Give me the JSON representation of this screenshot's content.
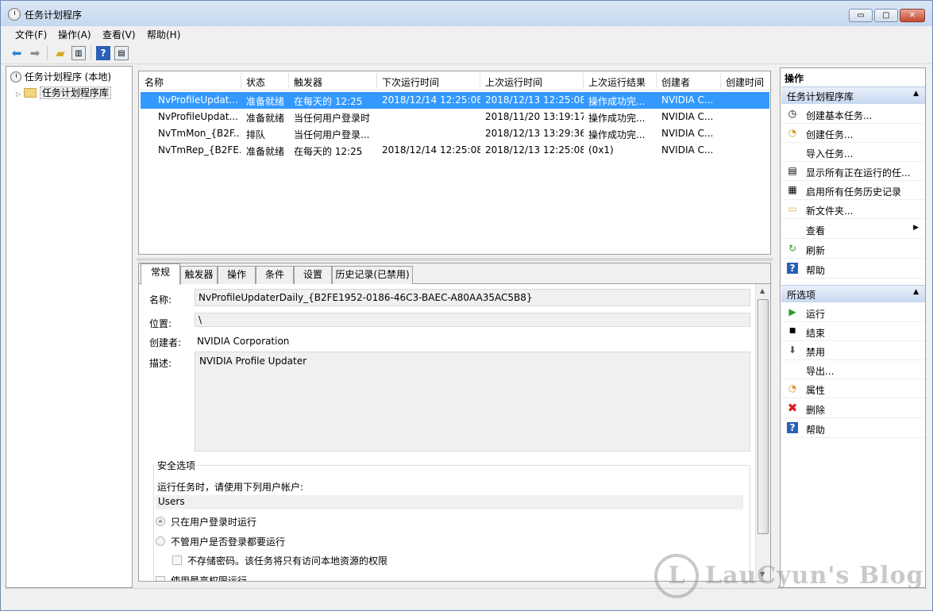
{
  "window": {
    "title": "任务计划程序",
    "buttons": {
      "minimize": "▭",
      "maximize": "▢",
      "close": "✕"
    }
  },
  "menu": [
    "文件(F)",
    "操作(A)",
    "查看(V)",
    "帮助(H)"
  ],
  "toolbar_icons": [
    "back-arrow-icon",
    "forward-arrow-icon",
    "up-folder-icon",
    "show-hide-tree-icon",
    "help-icon",
    "show-hide-action-pane-icon"
  ],
  "tree": {
    "root": "任务计划程序 (本地)",
    "child": "任务计划程序库"
  },
  "task_list": {
    "columns": [
      "名称",
      "状态",
      "触发器",
      "下次运行时间",
      "上次运行时间",
      "上次运行结果",
      "创建者",
      "创建时间"
    ],
    "rows": [
      {
        "name": "NvProfileUpdat...",
        "status": "准备就绪",
        "trigger": "在每天的 12:25",
        "next": "2018/12/14 12:25:08",
        "last": "2018/12/13 12:25:08",
        "result": "操作成功完...",
        "author": "NVIDIA C..."
      },
      {
        "name": "NvProfileUpdat...",
        "status": "准备就绪",
        "trigger": "当任何用户登录时",
        "next": "",
        "last": "2018/11/20 13:19:17",
        "result": "操作成功完...",
        "author": "NVIDIA C..."
      },
      {
        "name": "NvTmMon_{B2F...",
        "status": "排队",
        "trigger": "当任何用户登录...",
        "next": "",
        "last": "2018/12/13 13:29:36",
        "result": "操作成功完...",
        "author": "NVIDIA C..."
      },
      {
        "name": "NvTmRep_{B2FE...",
        "status": "准备就绪",
        "trigger": "在每天的 12:25",
        "next": "2018/12/14 12:25:08",
        "last": "2018/12/13 12:25:08",
        "result": "(0x1)",
        "author": "NVIDIA C..."
      }
    ]
  },
  "details": {
    "tabs": [
      "常规",
      "触发器",
      "操作",
      "条件",
      "设置",
      "历史记录(已禁用)"
    ],
    "name_label": "名称:",
    "name_value": "NvProfileUpdaterDaily_{B2FE1952-0186-46C3-BAEC-A80AA35AC5B8}",
    "location_label": "位置:",
    "location_value": "\\",
    "author_label": "创建者:",
    "author_value": "NVIDIA Corporation",
    "desc_label": "描述:",
    "desc_value": "NVIDIA Profile Updater",
    "security": {
      "title": "安全选项",
      "run_as_label": "运行任务时，请使用下列用户帐户:",
      "user": "Users",
      "opt_logged_on": "只在用户登录时运行",
      "opt_whether": "不管用户是否登录都要运行",
      "no_store_pwd": "不存储密码。该任务将只有访问本地资源的权限",
      "highest": "使用最高权限运行"
    }
  },
  "actions": {
    "title": "操作",
    "section1": {
      "header": "任务计划程序库",
      "items": [
        {
          "label": "创建基本任务...",
          "icon": "create-basic-task-icon",
          "glyph": "◷"
        },
        {
          "label": "创建任务...",
          "icon": "create-task-icon",
          "glyph": "◔"
        },
        {
          "label": "导入任务...",
          "icon": "",
          "glyph": ""
        },
        {
          "label": "显示所有正在运行的任...",
          "icon": "running-tasks-icon",
          "glyph": "▤"
        },
        {
          "label": "启用所有任务历史记录",
          "icon": "history-icon",
          "glyph": "▦"
        },
        {
          "label": "新文件夹...",
          "icon": "new-folder-icon",
          "glyph": "▭"
        },
        {
          "label": "查看",
          "icon": "",
          "glyph": "",
          "submenu": "▶"
        },
        {
          "label": "刷新",
          "icon": "refresh-icon",
          "glyph": "↻"
        },
        {
          "label": "帮助",
          "icon": "help-icon",
          "glyph": "?"
        }
      ]
    },
    "section2": {
      "header": "所选项",
      "items": [
        {
          "label": "运行",
          "icon": "run-icon",
          "glyph": "▶"
        },
        {
          "label": "结束",
          "icon": "stop-icon",
          "glyph": "■"
        },
        {
          "label": "禁用",
          "icon": "disable-icon",
          "glyph": "⬇"
        },
        {
          "label": "导出...",
          "icon": "",
          "glyph": ""
        },
        {
          "label": "属性",
          "icon": "properties-icon",
          "glyph": "◔"
        },
        {
          "label": "删除",
          "icon": "delete-icon",
          "glyph": "✖"
        },
        {
          "label": "帮助",
          "icon": "help-icon",
          "glyph": "?"
        }
      ]
    }
  },
  "watermark": {
    "logo": "L",
    "text": "LauCyun's Blog"
  },
  "colors": {
    "selection": "#3399ff",
    "section_header": "#c8d8ef",
    "run": "#2a9d2a",
    "delete": "#d42020",
    "help": "#2a5fb5"
  }
}
